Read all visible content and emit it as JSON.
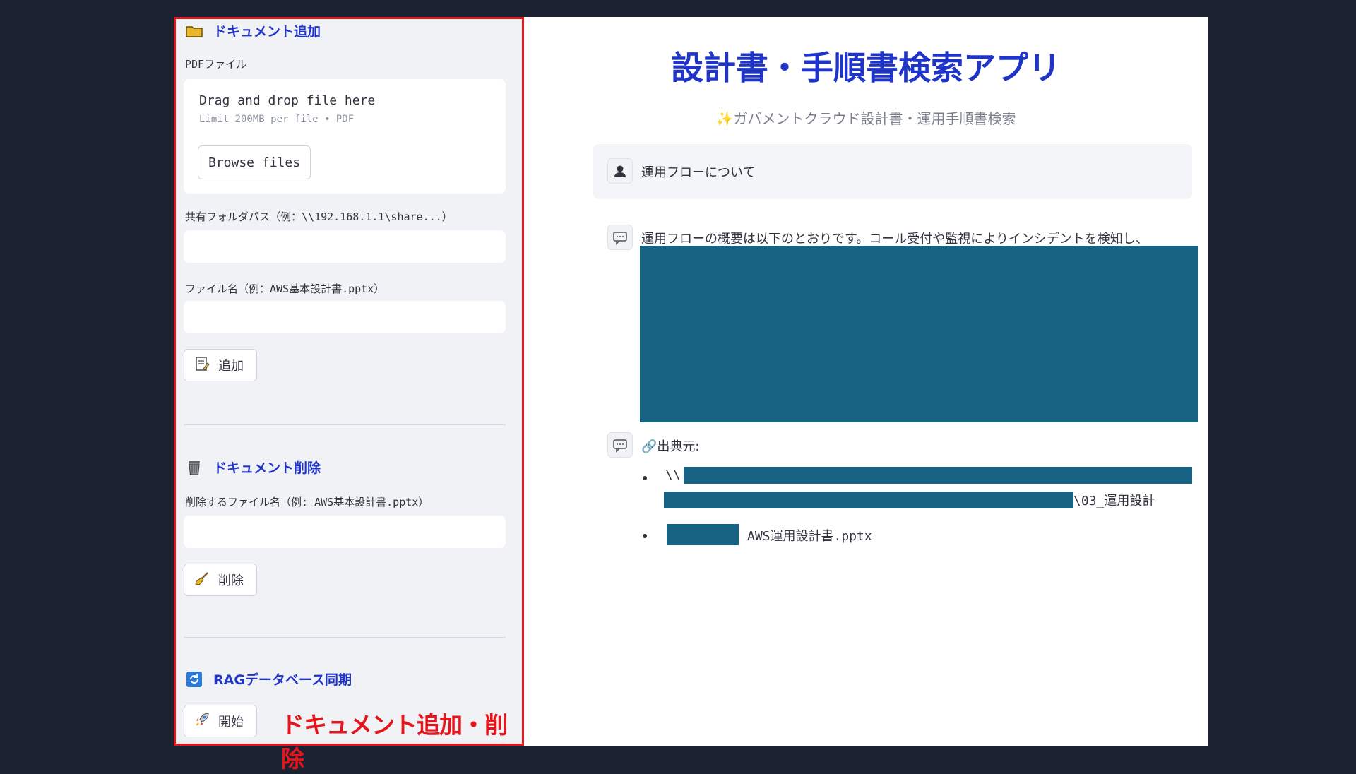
{
  "sidebar": {
    "add": {
      "title": "ドキュメント追加",
      "pdf_label": "PDFファイル",
      "dropzone_text": "Drag and drop file here",
      "dropzone_limit": "Limit 200MB per file • PDF",
      "browse_label": "Browse files",
      "share_label": "共有フォルダパス（例：\\\\192.168.1.1\\share...）",
      "share_value": "",
      "filename_label": "ファイル名（例：AWS基本設計書.pptx）",
      "filename_value": "",
      "add_button": "追加"
    },
    "delete": {
      "title": "ドキュメント削除",
      "filename_label": "削除するファイル名（例: AWS基本設計書.pptx）",
      "filename_value": "",
      "delete_button": "削除"
    },
    "sync": {
      "title": "RAGデータベース同期",
      "start_button": "開始"
    },
    "annotation": "ドキュメント追加・削除"
  },
  "main": {
    "title": "設計書・手順書検索アプリ",
    "subtitle": "✨ガバメントクラウド設計書・運用手順書検索",
    "user_message": "運用フローについて",
    "assistant_message": "運用フローの概要は以下のとおりです。コール受付や監視によりインシデントを検知し、",
    "sources_label": "🔗出典元:",
    "source1_prefix": "\\\\",
    "source1_suffix": "\\03_運用設計",
    "source2_filename": "AWS運用設計書.pptx"
  },
  "colors": {
    "accent": "#1f34c9",
    "annotation_red": "#e5151b",
    "redaction": "#186283",
    "background": "#1b2130",
    "sidebar_bg": "#f0f2f6"
  }
}
